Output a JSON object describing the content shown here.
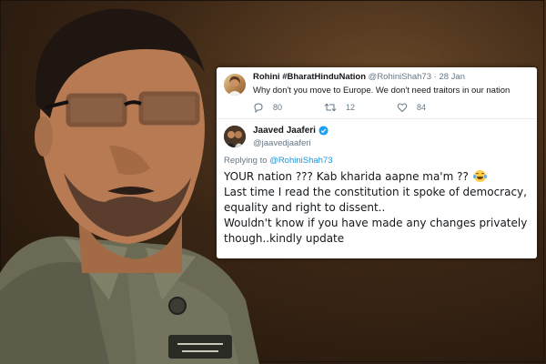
{
  "reply": {
    "name": "Rohini #BharatHinduNation",
    "handle": "@RohiniShah73",
    "separator": "·",
    "date": "28 Jan",
    "text": "Why don't you move to Europe. We don't need traitors in our nation",
    "replies": "80",
    "retweets": "12",
    "likes": "84"
  },
  "tweet": {
    "name": "Jaaved Jaaferi",
    "handle": "@jaavedjaaferi",
    "replying_prefix": "Replying to",
    "replying_to": "@RohiniShah73",
    "lines": [
      "YOUR nation ??? Kab kharida aapne ma'm ??",
      "Last time I read the constitution it spoke of democracy,",
      "equality and right to dissent..",
      "Wouldn't know if you have made any changes privately",
      "though..kindly update"
    ]
  },
  "colors": {
    "accent": "#1da1f2",
    "link": "#1b95e0",
    "muted": "#657786",
    "background": "#3b2615"
  },
  "icons": [
    "reply-icon",
    "retweet-icon",
    "like-icon",
    "verified-icon",
    "laughing-emoji-icon"
  ]
}
